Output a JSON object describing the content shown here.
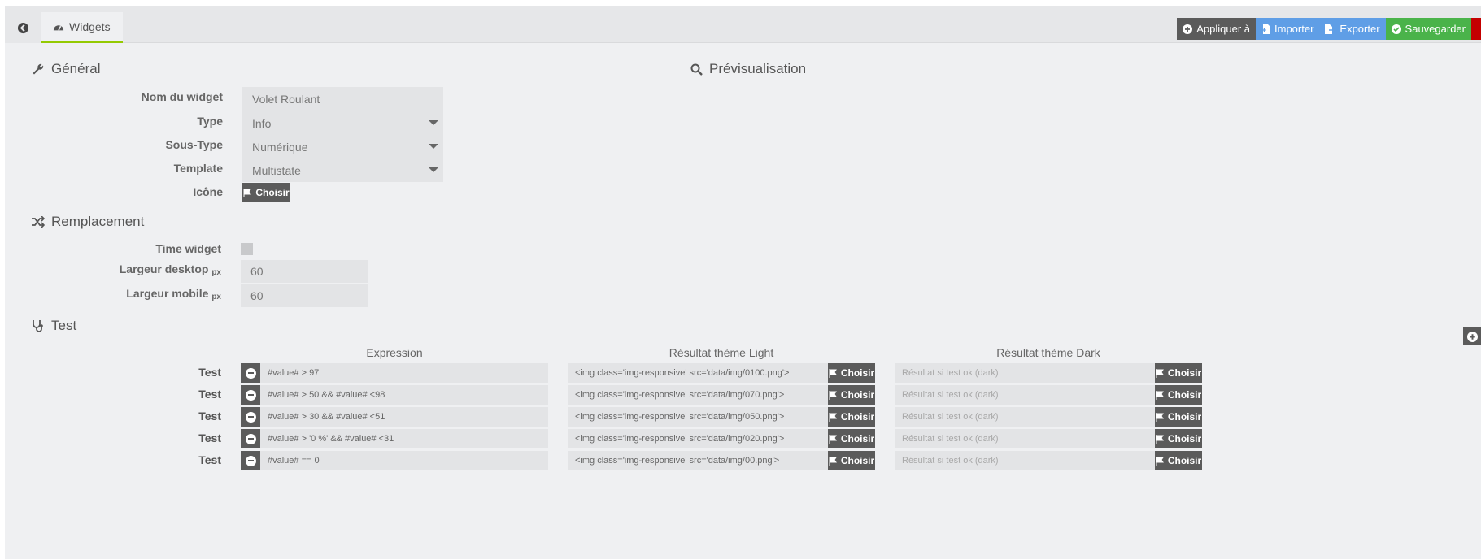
{
  "tabs": {
    "widgets": "Widgets"
  },
  "actions": {
    "apply": "Appliquer à",
    "import": "Importer",
    "export": "Exporter",
    "save": "Sauvegarder"
  },
  "general": {
    "title": "Général",
    "name_label": "Nom du widget",
    "name_value": "Volet Roulant",
    "type_label": "Type",
    "type_value": "Info",
    "subtype_label": "Sous-Type",
    "subtype_value": "Numérique",
    "template_label": "Template",
    "template_value": "Multistate",
    "icon_label": "Icône",
    "icon_button": "Choisir"
  },
  "preview": {
    "title": "Prévisualisation"
  },
  "replacement": {
    "title": "Remplacement",
    "time_widget_label": "Time widget",
    "desktop_width_label": "Largeur desktop",
    "desktop_width_unit": "px",
    "desktop_width_value": "60",
    "mobile_width_label": "Largeur mobile",
    "mobile_width_unit": "px",
    "mobile_width_value": "60"
  },
  "test": {
    "title": "Test",
    "columns": {
      "expression": "Expression",
      "light": "Résultat thème Light",
      "dark": "Résultat thème Dark"
    },
    "choose_label": "Choisir",
    "rows": [
      {
        "label": "Test",
        "expression": "#value# > 97",
        "light": "<img class='img-responsive' src='data/img/0100.png'>",
        "dark": "Résultat si test ok (dark)"
      },
      {
        "label": "Test",
        "expression": "#value# > 50 && #value# <98",
        "light": "<img class='img-responsive' src='data/img/070.png'>",
        "dark": "Résultat si test ok (dark)"
      },
      {
        "label": "Test",
        "expression": "#value# > 30 && #value# <51",
        "light": "<img class='img-responsive' src='data/img/050.png'>",
        "dark": "Résultat si test ok (dark)"
      },
      {
        "label": "Test",
        "expression": "#value# > '0 %'  && #value# <31",
        "light": "<img class='img-responsive' src='data/img/020.png'>",
        "dark": "Résultat si test ok (dark)"
      },
      {
        "label": "Test",
        "expression": "#value# == 0",
        "light": "<img class='img-responsive' src='data/img/00.png'>",
        "dark": "Résultat si test ok (dark)"
      }
    ]
  },
  "colors": {
    "accent_green": "#94ca02",
    "btn_dark": "#5b5b5b",
    "btn_blue": "#5f9ee6",
    "btn_green": "#4ab34a",
    "btn_red": "#c40000"
  }
}
